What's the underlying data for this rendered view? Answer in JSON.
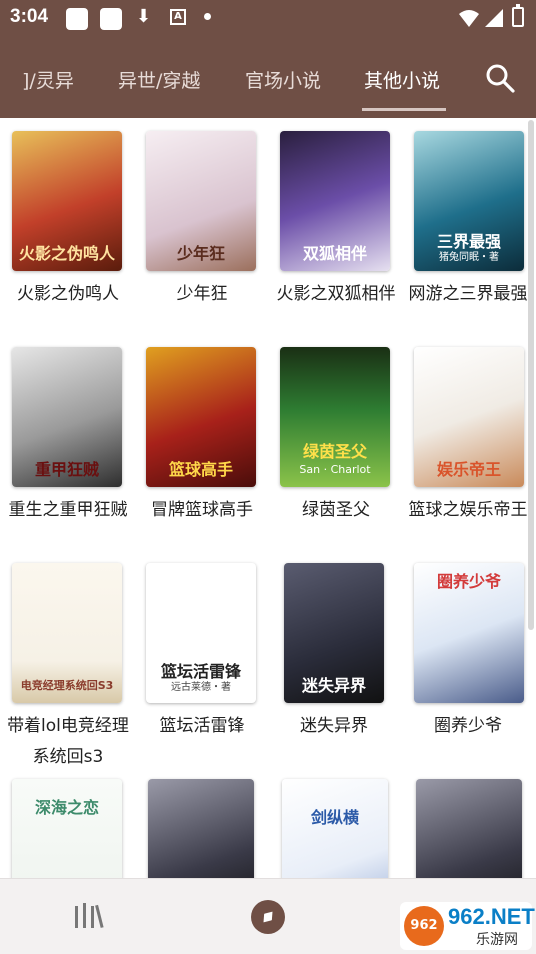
{
  "status_bar": {
    "time": "3:04",
    "abox": "A"
  },
  "tabs": [
    {
      "label": "]/灵异",
      "active": false
    },
    {
      "label": "异世/穿越",
      "active": false
    },
    {
      "label": "官场小说",
      "active": false
    },
    {
      "label": "其他小说",
      "active": true
    }
  ],
  "books": [
    {
      "name": "火影之伪鸣人",
      "cover_text": "火影之伪鸣人",
      "cover_bg": "#c2402a",
      "cover_fg": "#ffe3a0"
    },
    {
      "name": "少年狂",
      "cover_text": "少年狂",
      "cover_bg": "#efe3e8",
      "cover_fg": "#5a2c1e"
    },
    {
      "name": "火影之双狐相伴",
      "cover_text": "双狐相伴",
      "cover_bg": "#6b4ea8",
      "cover_fg": "#ffffff"
    },
    {
      "name": "网游之三界最强",
      "cover_text": "三界最强",
      "cover_bg": "#1f6f8b",
      "cover_fg": "#ffffff",
      "cover_sub": "猪兔同眠・著"
    },
    {
      "name": "重生之重甲狂贼",
      "cover_text": "重甲狂贼",
      "cover_bg": "#bdbdbd",
      "cover_fg": "#6a0f0f"
    },
    {
      "name": "冒牌篮球高手",
      "cover_text": "篮球高手",
      "cover_bg": "#a8211a",
      "cover_fg": "#ffd84a"
    },
    {
      "name": "绿茵圣父",
      "cover_text": "绿茵圣父",
      "cover_bg": "#2e7d32",
      "cover_fg": "#ffe04a",
      "cover_sub": "San · Charlot"
    },
    {
      "name": "篮球之娱乐帝王",
      "cover_text": "娱乐帝王",
      "cover_bg": "#f0ebe4",
      "cover_fg": "#d9542b"
    },
    {
      "name": "带着lol电竞经理系统回s3",
      "cover_text": "电竞经理系统回S3",
      "cover_bg": "#f6f1e6",
      "cover_fg": "#8a3b2c"
    },
    {
      "name": "篮坛活雷锋",
      "cover_text": "篮坛活雷锋",
      "cover_bg": "#ffffff",
      "cover_fg": "#222222",
      "cover_sub": "远古莱德・著"
    },
    {
      "name": "迷失异界",
      "cover_text": "迷失异界",
      "cover_bg": "#2a2c3a",
      "cover_fg": "#ffffff"
    },
    {
      "name": "圈养少爷",
      "cover_text": "圈养少爷",
      "cover_bg": "#dce6f4",
      "cover_fg": "#d33b3b"
    },
    {
      "name": "",
      "cover_text": "深海之恋",
      "cover_bg": "#eef3ee",
      "cover_fg": "#3d8b6b"
    },
    {
      "name": "",
      "cover_text": "",
      "cover_bg": "#3a3a48",
      "cover_fg": "#ffffff"
    },
    {
      "name": "",
      "cover_text": "剑纵横",
      "cover_bg": "#e8eef8",
      "cover_fg": "#2b5aa8"
    },
    {
      "name": "",
      "cover_text": "",
      "cover_bg": "#3a3a48",
      "cover_fg": "#ffffff"
    }
  ],
  "watermark": {
    "logo": "962",
    "top": "962.NET",
    "bottom": "乐游网"
  },
  "colors": {
    "accent": "#6f4f45"
  }
}
